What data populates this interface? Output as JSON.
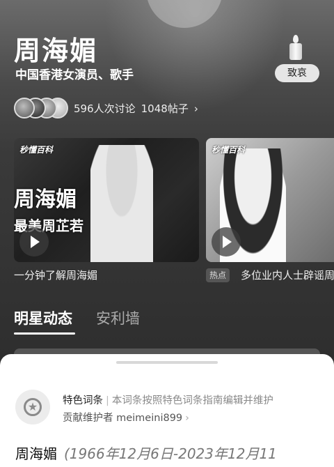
{
  "hero": {
    "name": "周海媚",
    "subtitle": "中国香港女演员、歌手",
    "mourn_button": "致哀",
    "discussion_count": "596人次讨论",
    "post_count": "1048帖子",
    "chevron": "›"
  },
  "videos": [
    {
      "brand": "秒懂百科",
      "overlay_title": "周海媚",
      "overlay_sub": "最美周芷若",
      "caption": "一分钟了解周海媚"
    },
    {
      "brand": "秒懂百科",
      "badge": "热点",
      "caption": "多位业内人士辟谣周"
    }
  ],
  "tabs": [
    {
      "label": "明星动态",
      "active": true
    },
    {
      "label": "安利墙",
      "active": false
    }
  ],
  "sheet": {
    "feature_tag": "特色词条",
    "separator": "|",
    "feature_desc": "本词条按照特色词条指南编辑并维护",
    "maintainer": "贡献维护者 meimeini899",
    "chevron": "›",
    "entry_name": "周海媚",
    "entry_life": "(1966年12月6日-2023年12月11"
  },
  "icons": [
    "candle-icon",
    "play-icon",
    "featured-entry-icon",
    "chevron-right-icon"
  ],
  "colors": {
    "sheet_bg": "#ffffff",
    "mourn_btn_bg": "#e6e6e6"
  }
}
